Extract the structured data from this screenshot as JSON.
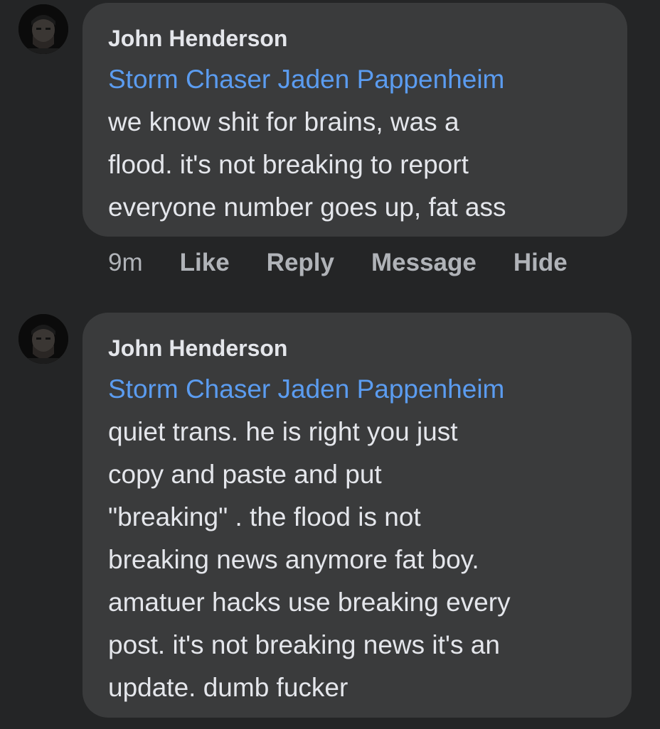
{
  "comments": [
    {
      "author": "John Henderson",
      "mention": "Storm Chaser Jaden Pappenheim",
      "lines": [
        "we know shit for brains, was a",
        "flood. it's not breaking to report",
        "everyone number goes up, fat ass"
      ],
      "actions": {
        "time": "9m",
        "like": "Like",
        "reply": "Reply",
        "message": "Message",
        "hide": "Hide"
      }
    },
    {
      "author": "John Henderson",
      "mention": "Storm Chaser Jaden Pappenheim",
      "lines": [
        "quiet trans. he is right you just",
        "copy and paste and put",
        "\"breaking\" . the flood is not",
        "breaking news anymore fat boy.",
        "amatuer hacks use breaking every",
        "post. it's not breaking news it's an",
        "update. dumb fucker"
      ]
    }
  ],
  "avatar_icon": "profile-photo"
}
